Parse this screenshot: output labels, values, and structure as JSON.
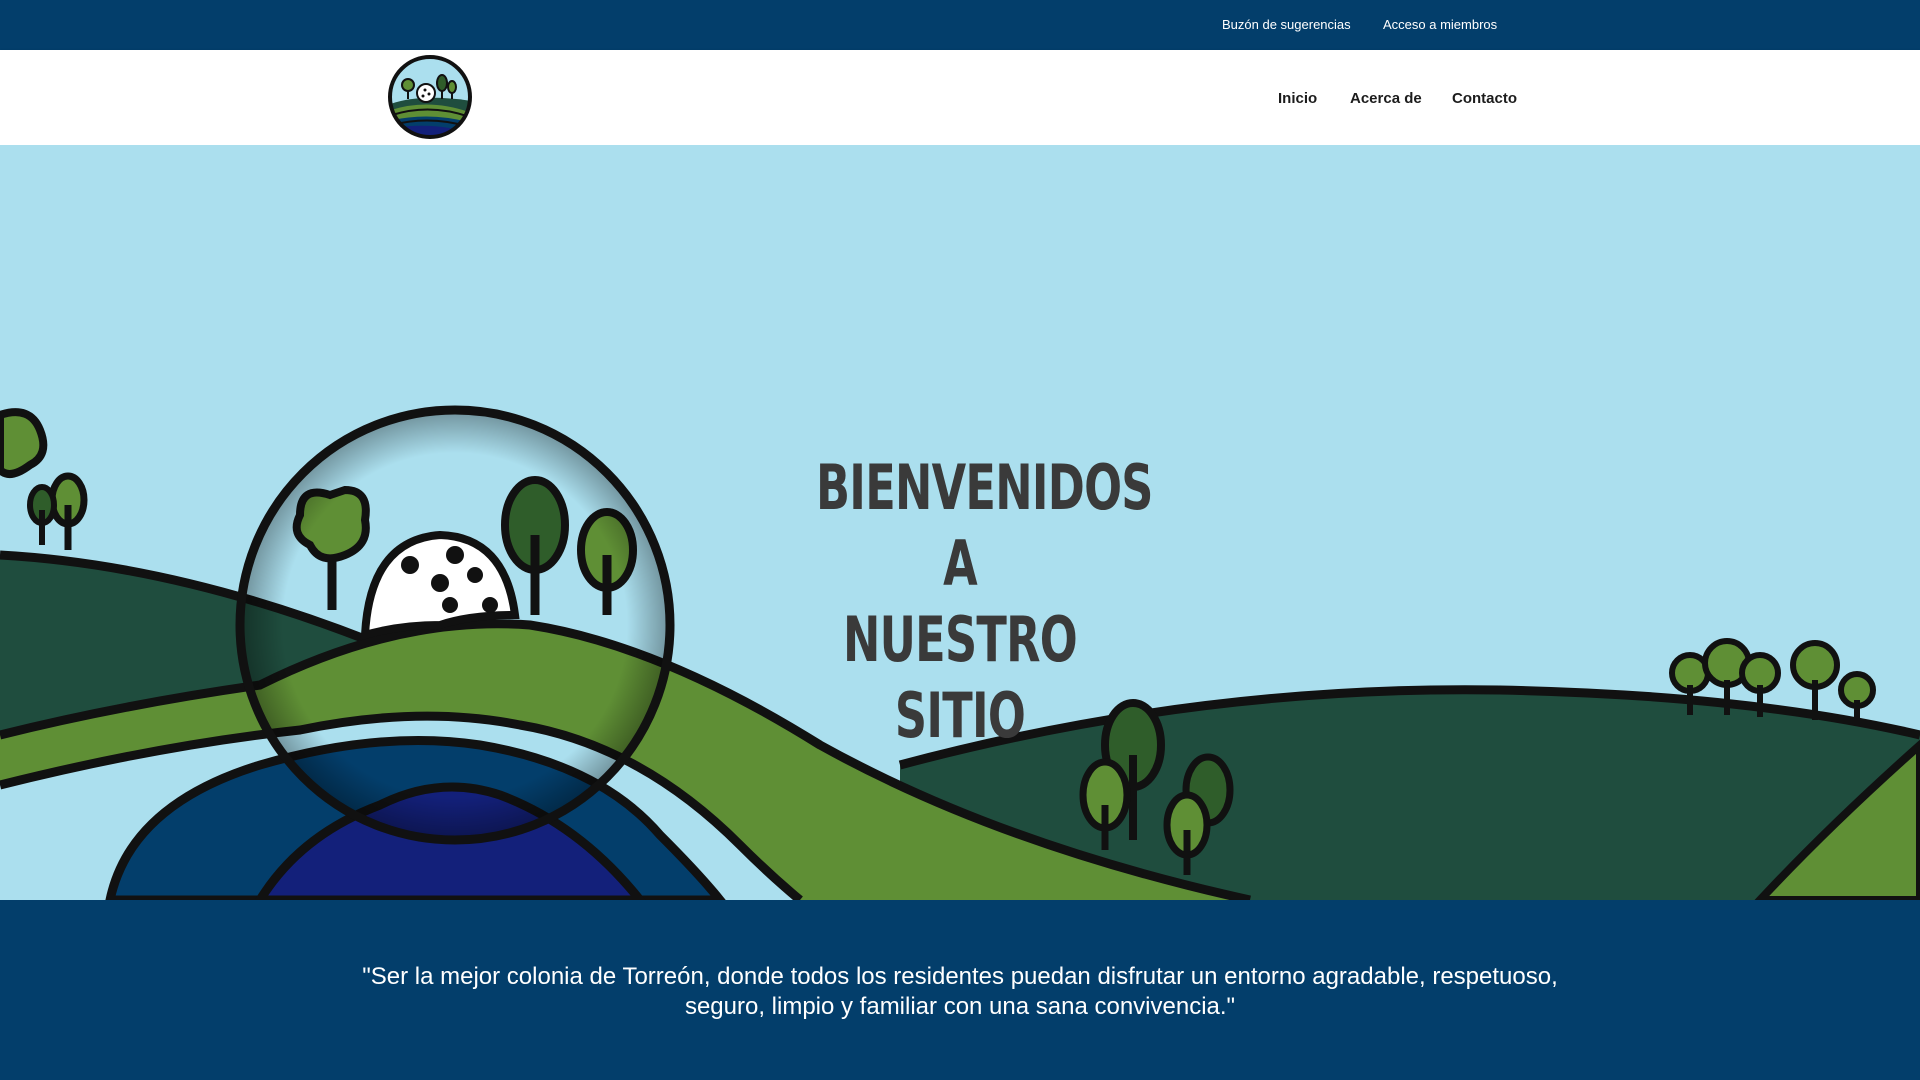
{
  "topbar": {
    "suggestions_label": "Buzón de sugerencias",
    "members_label": "Acceso a miembros"
  },
  "nav": {
    "home_label": "Inicio",
    "about_label": "Acerca de",
    "contact_label": "Contacto"
  },
  "hero": {
    "title_line1": "BIENVENIDOS A",
    "title_line2": "NUESTRO SITIO"
  },
  "mission": {
    "text": "\"Ser la mejor colonia de Torreón, donde todos los residentes puedan disfrutar un entorno agradable, respetuoso, seguro, limpio y familiar con una sana convivencia.\""
  },
  "colors": {
    "brand_navy": "#033e6b",
    "sky": "#abdfee",
    "dark_green": "#1f4d3e",
    "light_green": "#5f8f35",
    "water_blue": "#033e6b",
    "deep_blue": "#13207a"
  }
}
